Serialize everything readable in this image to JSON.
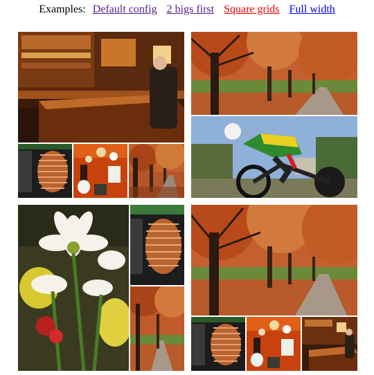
{
  "nav": {
    "label": "Examples:",
    "links": [
      {
        "label": "Default config",
        "state": "visited",
        "color": "#551a8b"
      },
      {
        "label": "2 bigs first",
        "state": "visited",
        "color": "#551a8b"
      },
      {
        "label": "Square grids",
        "state": "active",
        "color": "#ee0000"
      },
      {
        "label": "Full width",
        "state": "link",
        "color": "#0000ee"
      }
    ]
  },
  "photos": {
    "bar": "bar interior photo",
    "trees": "autumn tree-lined path photo",
    "cyclist": "time-trial cyclist photo",
    "coil": "copper coil photo",
    "guitars": "guitar wall photo",
    "flowers": "white daisies photo"
  },
  "sky_color": "#8fb0d8"
}
